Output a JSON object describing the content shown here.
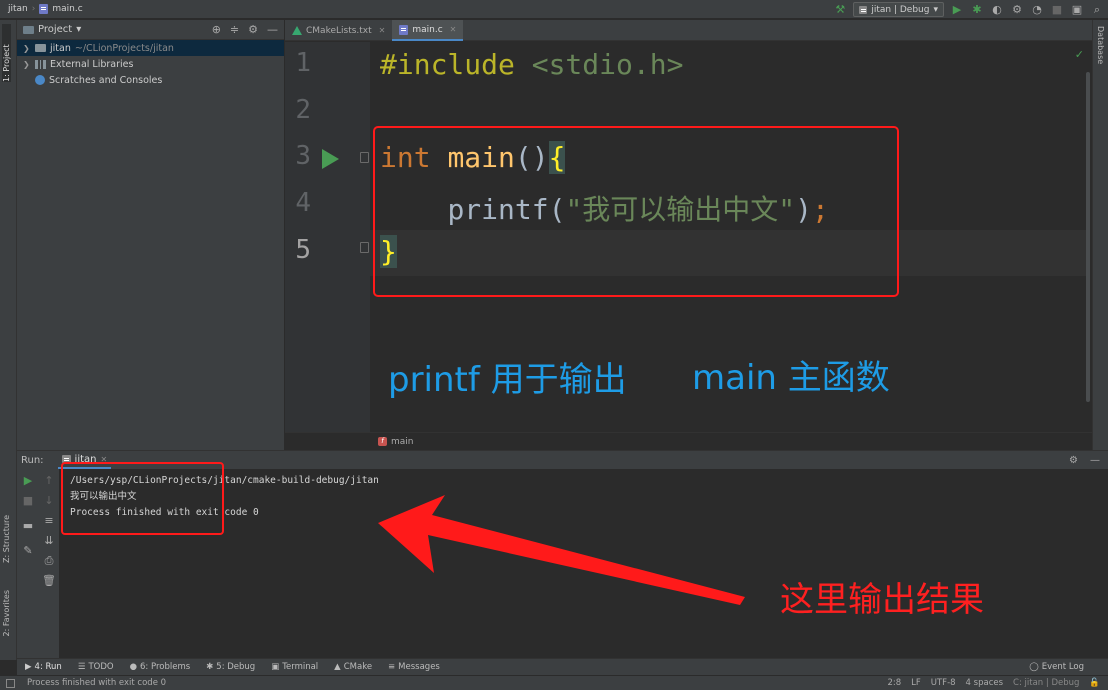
{
  "breadcrumb": {
    "project": "jitan",
    "file": "main.c"
  },
  "toolbar": {
    "run_config": "jitan | Debug"
  },
  "left_stripe": {
    "project_tab": "1: Project",
    "structure_tab": "Z: Structure",
    "favorites_tab": "2: Favorites"
  },
  "right_stripe": {
    "database_tab": "Database"
  },
  "project_panel": {
    "title": "Project",
    "items": [
      {
        "label": "jitan",
        "path": "~/CLionProjects/jitan"
      },
      {
        "label": "External Libraries",
        "path": ""
      },
      {
        "label": "Scratches and Consoles",
        "path": ""
      }
    ]
  },
  "tabs": [
    {
      "label": "CMakeLists.txt"
    },
    {
      "label": "main.c"
    }
  ],
  "editor": {
    "line_numbers": [
      "1",
      "2",
      "3",
      "4",
      "5"
    ],
    "line1": {
      "directive": "#include",
      "header": "<stdio.h>"
    },
    "line3": {
      "keyword": "int",
      "func": "main",
      "parens": "()",
      "brace": "{"
    },
    "line4": {
      "indent": "    ",
      "func": "printf",
      "open": "(",
      "string": "\"我可以输出中文\"",
      "close": ")",
      "semi": ";"
    },
    "line5": {
      "brace": "}"
    },
    "breadcrumb_fn": "main"
  },
  "annotations": {
    "printf_note": "printf 用于输出",
    "main_note": "main 主函数",
    "output_note": "这里输出结果"
  },
  "run_panel": {
    "label": "Run:",
    "tab": "jitan",
    "console_lines": [
      "/Users/ysp/CLionProjects/jitan/cmake-build-debug/jitan",
      "我可以输出中文",
      "",
      "Process finished with exit code 0"
    ]
  },
  "bottom_tools": [
    {
      "label": "4: Run"
    },
    {
      "label": "TODO"
    },
    {
      "label": "6: Problems"
    },
    {
      "label": "5: Debug"
    },
    {
      "label": "Terminal"
    },
    {
      "label": "CMake"
    },
    {
      "label": "Messages"
    }
  ],
  "event_log": "Event Log",
  "status": {
    "message": "Process finished with exit code 0",
    "position": "2:8",
    "line_sep": "LF",
    "encoding": "UTF-8",
    "indent": "4 spaces",
    "context": "C: jitan | Debug"
  },
  "colors": {
    "annotation_red": "#ff1a1a",
    "annotation_blue": "#1e9ce6",
    "run_green": "#499c54"
  }
}
